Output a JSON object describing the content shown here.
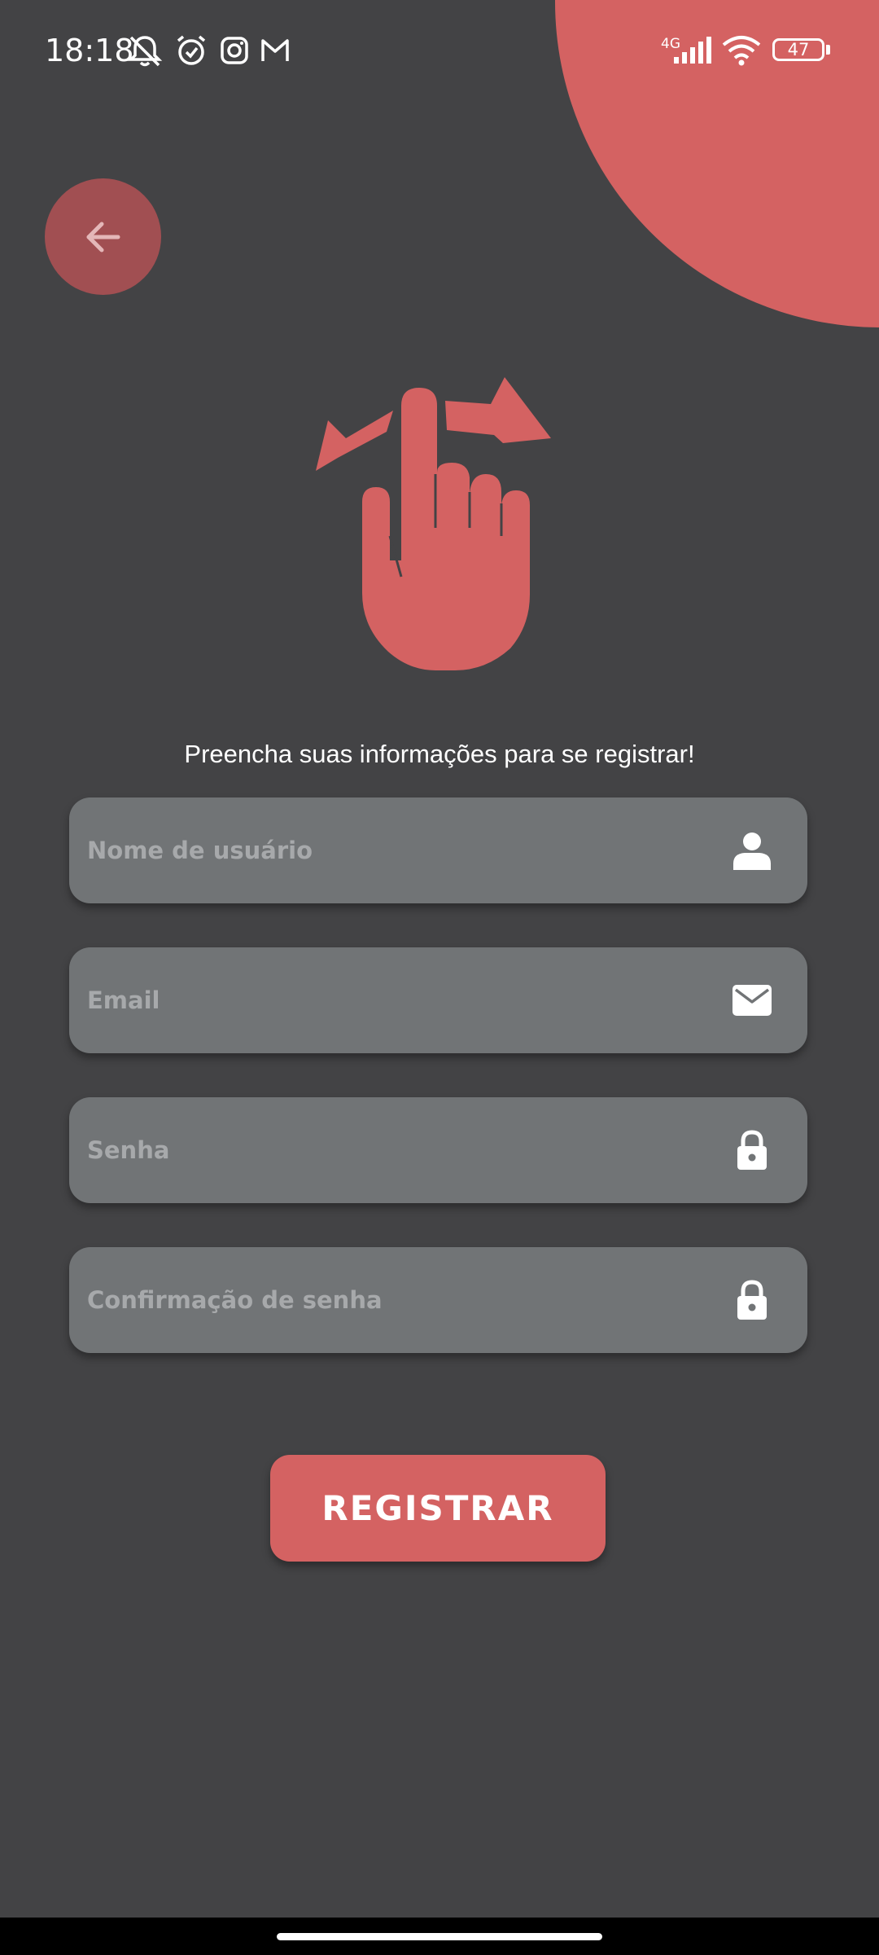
{
  "status_bar": {
    "time": "18:18",
    "network": "4G",
    "battery": "47",
    "icons": [
      "muted-bell-icon",
      "alarm-icon",
      "instagram-icon",
      "gmail-icon",
      "signal-icon",
      "wifi-icon",
      "battery-icon"
    ]
  },
  "back_button": {
    "icon": "arrow-left-icon"
  },
  "illustration": {
    "icon": "swipe-hand-icon",
    "color": "#d46262"
  },
  "form": {
    "intro": "Preencha suas informações para se registrar!",
    "fields": [
      {
        "placeholder": "Nome de usuário",
        "value": "",
        "icon": "person-icon"
      },
      {
        "placeholder": "Email",
        "value": "",
        "icon": "mail-icon"
      },
      {
        "placeholder": "Senha",
        "value": "",
        "icon": "lock-icon"
      },
      {
        "placeholder": "Confirmação de senha",
        "value": "",
        "icon": "lock-icon"
      }
    ],
    "submit_label": "REGISTRAR"
  },
  "colors": {
    "background": "#434345",
    "accent": "#d46262",
    "field": "#717476"
  }
}
